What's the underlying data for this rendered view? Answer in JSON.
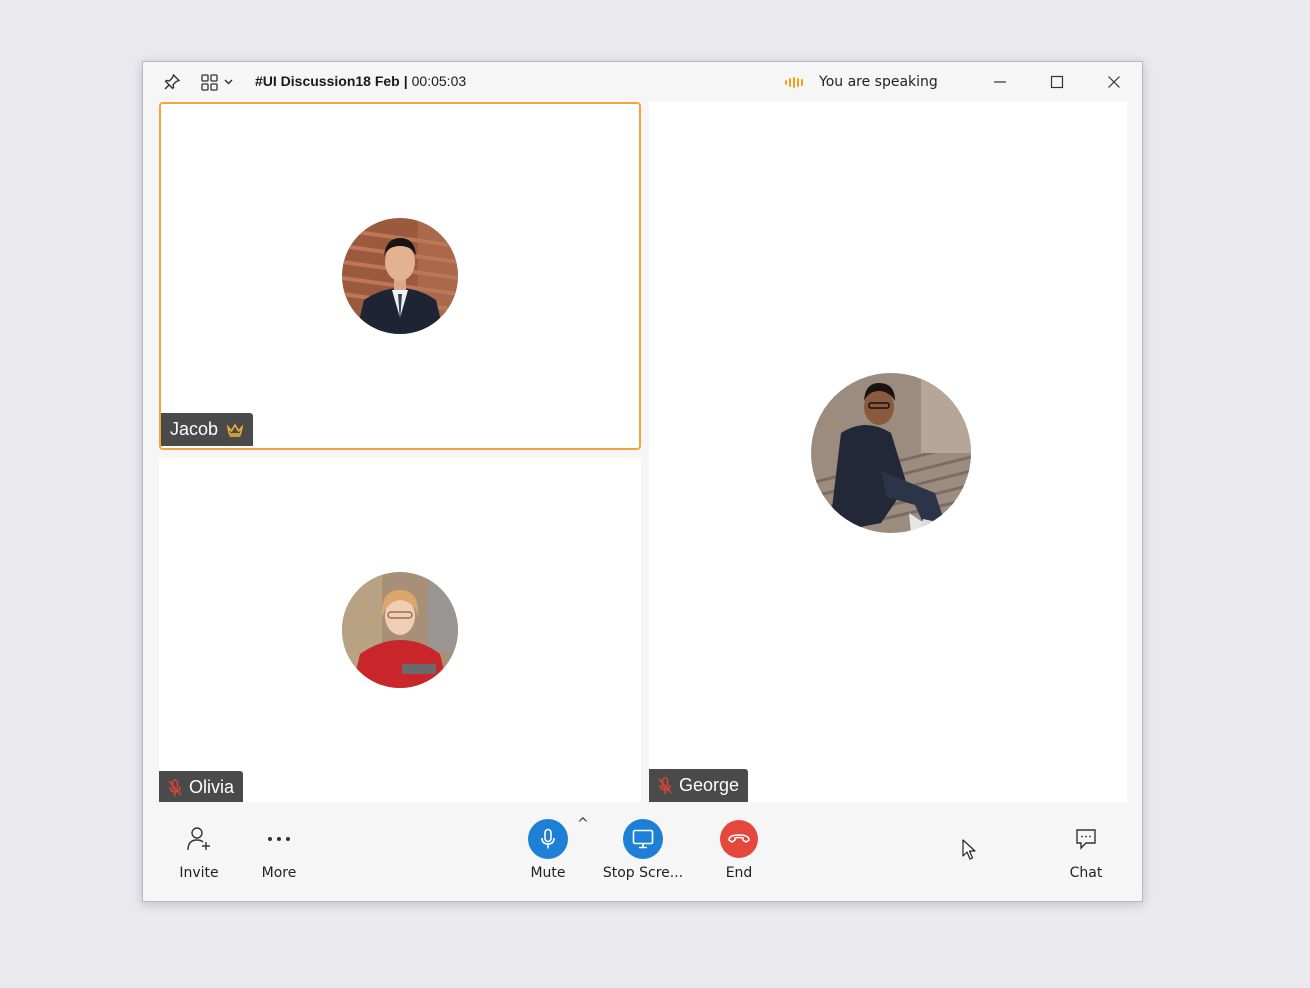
{
  "window": {
    "title": "#UI Discussion18 Feb",
    "separator": "|",
    "timer": "00:05:03",
    "speaking_status": "You are speaking"
  },
  "participants": [
    {
      "name": "Jacob",
      "role": "host",
      "muted": false,
      "active_speaker": true
    },
    {
      "name": "Olivia",
      "muted": true
    },
    {
      "name": "George",
      "muted": true
    }
  ],
  "toolbar": {
    "invite_label": "Invite",
    "more_label": "More",
    "mute_label": "Mute",
    "share_label": "Stop Scre...",
    "end_label": "End",
    "chat_label": "Chat"
  },
  "colors": {
    "accent_blue": "#1d7fd6",
    "end_red": "#e5473d",
    "speaker_border": "#f5a341",
    "speaking_bars": "#f0a020",
    "muted_mic": "#e0433a"
  },
  "icons": [
    "pin-icon",
    "layout-grid-icon",
    "speaking-bars-icon",
    "minimize-icon",
    "maximize-icon",
    "close-icon",
    "crown-icon",
    "mic-muted-icon",
    "invite-icon",
    "more-icon",
    "mic-icon",
    "screen-share-icon",
    "end-call-icon",
    "chat-icon",
    "cursor-icon"
  ]
}
